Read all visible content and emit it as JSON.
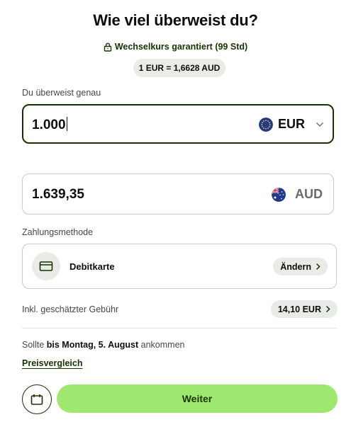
{
  "header": {
    "title": "Wie viel überweist du?",
    "guarantee_text": "Wechselkurs garantiert (99 Std)",
    "rate_text": "1 EUR = 1,6628 AUD"
  },
  "send": {
    "label": "Du überweist genau",
    "amount": "1.000",
    "currency": "EUR"
  },
  "receive": {
    "amount": "1.639,35",
    "currency": "AUD"
  },
  "payment": {
    "label": "Zahlungsmethode",
    "method": "Debitkarte",
    "change_label": "Ändern"
  },
  "fee": {
    "label": "Inkl. geschätzter Gebühr",
    "value": "14,10 EUR"
  },
  "arrival": {
    "prefix": "Sollte",
    "date": "bis Montag, 5. August",
    "suffix": "ankommen"
  },
  "compare_link": "Preisvergleich",
  "continue_label": "Weiter",
  "colors": {
    "brand_dark": "#163300",
    "brand_green": "#9fe870",
    "pill_bg": "#e8ebe6",
    "border": "#c9cbc7"
  },
  "icons": [
    "lock-icon",
    "eu-flag-icon",
    "chevron-down-icon",
    "au-flag-icon",
    "card-icon",
    "chevron-right-icon",
    "calendar-icon"
  ]
}
